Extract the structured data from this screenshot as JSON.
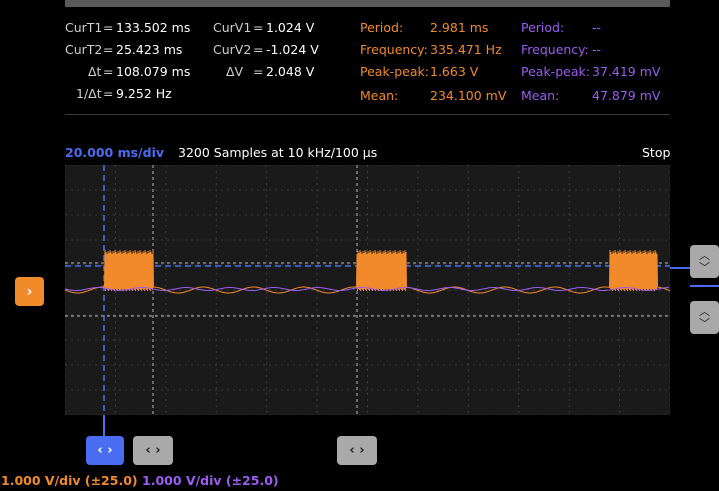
{
  "cursors": {
    "curt1": {
      "label": "CurT1",
      "eq": "=",
      "value": "133.502 ms"
    },
    "curt2": {
      "label": "CurT2",
      "eq": "=",
      "value": "25.423 ms"
    },
    "dt": {
      "label": "Δt",
      "eq": "=",
      "value": "108.079 ms"
    },
    "inv_dt": {
      "label": "1/Δt",
      "eq": "=",
      "value": "9.252 Hz"
    },
    "curv1": {
      "label": "CurV1",
      "eq": "=",
      "value": "1.024 V"
    },
    "curv2": {
      "label": "CurV2",
      "eq": "=",
      "value": "-1.024 V"
    },
    "dv": {
      "label": "ΔV",
      "eq": "=",
      "value": "2.048 V"
    }
  },
  "measure_ch1": {
    "period": {
      "label": "Period:",
      "value": "2.981 ms"
    },
    "frequency": {
      "label": "Frequency:",
      "value": "335.471 Hz"
    },
    "peak_peak": {
      "label": "Peak-peak:",
      "value": "1.663 V"
    },
    "mean": {
      "label": "Mean:",
      "value": "234.100 mV"
    }
  },
  "measure_ch2": {
    "period": {
      "label": "Period:",
      "value": "--"
    },
    "frequency": {
      "label": "Frequency:",
      "value": "--"
    },
    "peak_peak": {
      "label": "Peak-peak:",
      "value": "37.419 mV"
    },
    "mean": {
      "label": "Mean:",
      "value": "47.879 mV"
    }
  },
  "timebase": "20.000 ms/div",
  "samples": "3200 Samples at 10 kHz/100 µs",
  "run_state": "Stop",
  "ch1_scale": "1.000 V/div (±25.0)",
  "ch2_scale": "1.000 V/div (±25.0)",
  "colors": {
    "ch1": "#f08a2a",
    "ch2": "#9b5cf0",
    "cursor": "#4a6cf0",
    "grid": "#3c3c3c"
  },
  "icons": {
    "trigger": "chevron-right-icon",
    "h_cursor": "left-right-chevrons-icon",
    "v_cursor": "up-down-chevrons-icon"
  }
}
